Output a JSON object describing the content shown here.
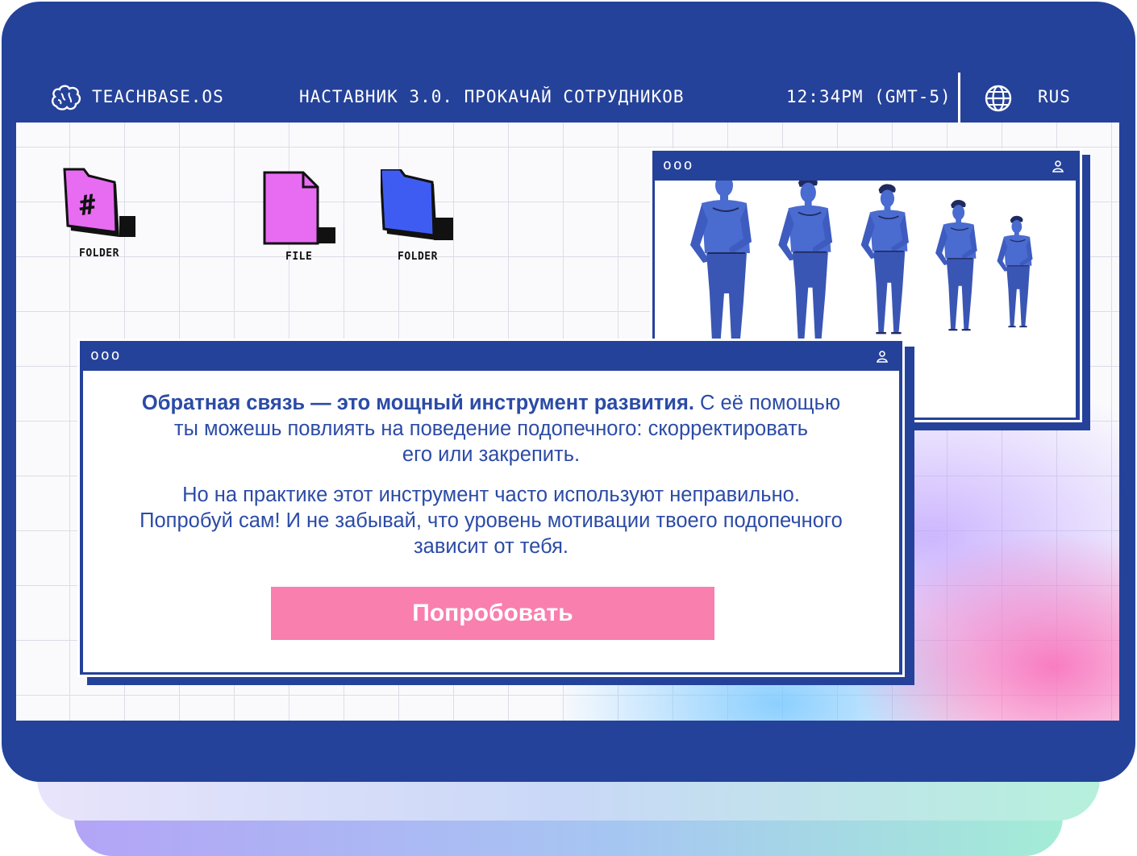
{
  "topbar": {
    "brand": "TEACHBASE.OS",
    "title": "НАСТАВНИК 3.0. ПРОКАЧАЙ СОТРУДНИКОВ",
    "time": "12:34PM (GMT-5)",
    "language": "RUS",
    "brand_icon": "brain-icon",
    "language_icon": "globe-icon"
  },
  "desktop": {
    "icons": [
      {
        "label": "FOLDER",
        "icon": "folder-hash-icon",
        "color": "#e86cf2"
      },
      {
        "label": "FILE",
        "icon": "file-icon",
        "color": "#e86cf2"
      },
      {
        "label": "FOLDER",
        "icon": "folder-icon",
        "color": "#3f5cf2"
      }
    ]
  },
  "illustration_window": {
    "controls": "ooo",
    "user_icon": "user-icon",
    "figures_count": 5
  },
  "message_window": {
    "controls": "ooo",
    "user_icon": "user-icon",
    "paragraph1_bold": "Обратная связь — это мощный инструмент развития.",
    "paragraph1_rest_line1": " С её помощью",
    "paragraph1_line2": "ты можешь повлиять на поведение подопечного: скорректировать",
    "paragraph1_line3": "его или закрепить.",
    "paragraph2_line1": "Но на практике этот инструмент часто используют неправильно.",
    "paragraph2_line2": "Попробуй сам! И не забывай, что уровень мотивации твоего подопечного",
    "paragraph2_line3": "зависит от тебя.",
    "button_label": "Попробовать"
  },
  "colors": {
    "frame": "#25429a",
    "text": "#2b4ba6",
    "button": "#f97fae",
    "pink": "#e86cf2",
    "blue": "#3f5cf2"
  }
}
